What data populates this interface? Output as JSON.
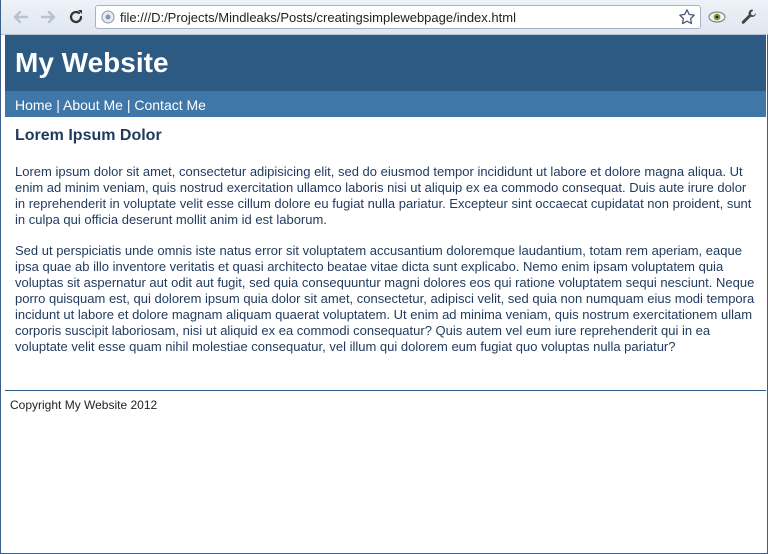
{
  "browser": {
    "url": "file:///D:/Projects/Mindleaks/Posts/creatingsimplewebpage/index.html",
    "icons": {
      "back": "back-arrow-icon",
      "forward": "forward-arrow-icon",
      "reload": "reload-icon",
      "page": "page-icon",
      "bookmark": "star-icon",
      "extension": "eye-icon",
      "settings": "wrench-icon"
    }
  },
  "site": {
    "title": "My Website",
    "nav": [
      {
        "label": "Home"
      },
      {
        "label": "About Me"
      },
      {
        "label": "Contact Me"
      }
    ],
    "nav_separator": "|",
    "heading": "Lorem Ipsum Dolor",
    "paragraphs": [
      "Lorem ipsum dolor sit amet, consectetur adipisicing elit, sed do eiusmod tempor incididunt ut labore et dolore magna aliqua. Ut enim ad minim veniam, quis nostrud exercitation ullamco laboris nisi ut aliquip ex ea commodo consequat. Duis aute irure dolor in reprehenderit in voluptate velit esse cillum dolore eu fugiat nulla pariatur. Excepteur sint occaecat cupidatat non proident, sunt in culpa qui officia deserunt mollit anim id est laborum.",
      "Sed ut perspiciatis unde omnis iste natus error sit voluptatem accusantium doloremque laudantium, totam rem aperiam, eaque ipsa quae ab illo inventore veritatis et quasi architecto beatae vitae dicta sunt explicabo. Nemo enim ipsam voluptatem quia voluptas sit aspernatur aut odit aut fugit, sed quia consequuntur magni dolores eos qui ratione voluptatem sequi nesciunt. Neque porro quisquam est, qui dolorem ipsum quia dolor sit amet, consectetur, adipisci velit, sed quia non numquam eius modi tempora incidunt ut labore et dolore magnam aliquam quaerat voluptatem. Ut enim ad minima veniam, quis nostrum exercitationem ullam corporis suscipit laboriosam, nisi ut aliquid ex ea commodi consequatur? Quis autem vel eum iure reprehenderit qui in ea voluptate velit esse quam nihil molestiae consequatur, vel illum qui dolorem eum fugiat quo voluptas nulla pariatur?"
    ],
    "footer": "Copyright My Website 2012"
  },
  "colors": {
    "header_bg": "#2d5a82",
    "nav_bg": "#3f77a9",
    "text": "#1f3a5e"
  }
}
